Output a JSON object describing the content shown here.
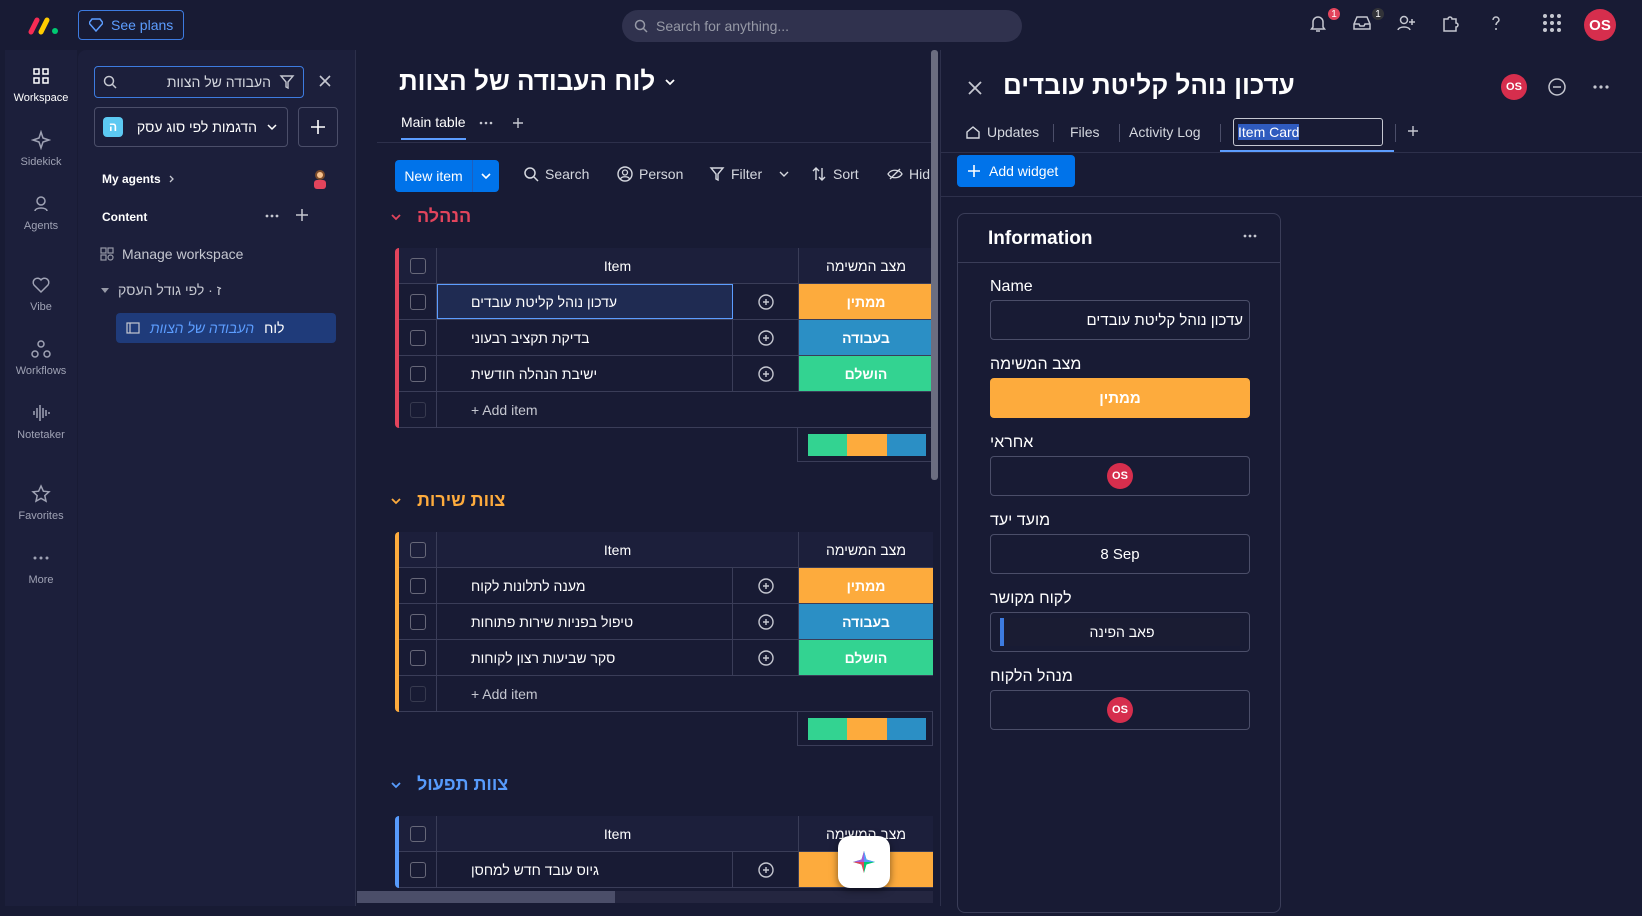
{
  "topbar": {
    "see_plans": "See plans",
    "search_placeholder": "Search for anything...",
    "notif_count": "1",
    "inbox_count": "1",
    "avatar": "OS"
  },
  "rail": {
    "items": [
      {
        "label": "Workspace",
        "icon": "grid-icon"
      },
      {
        "label": "Sidekick",
        "icon": "sparkle-icon"
      },
      {
        "label": "Agents",
        "icon": "agent-icon"
      },
      {
        "label": "Vibe",
        "icon": "heart-icon"
      },
      {
        "label": "Workflows",
        "icon": "workflow-icon"
      },
      {
        "label": "Notetaker",
        "icon": "waveform-icon"
      },
      {
        "label": "Favorites",
        "icon": "star-icon"
      },
      {
        "label": "More",
        "icon": "more-icon"
      }
    ]
  },
  "workspace": {
    "search_value": "העבודה של הצוות",
    "workspace_badge": "ה",
    "workspace_name": "הדגמות לפי סוג עסק",
    "my_agents": "My agents",
    "content": "Content",
    "manage": "Manage workspace",
    "folder": "ז · לפי גודל העסק",
    "board_prefix": "לוח",
    "board_highlight": "העבודה של הצוות"
  },
  "board": {
    "title": "לוח העבודה של הצוות",
    "tab_main": "Main table",
    "new_item": "New item",
    "tools": {
      "search": "Search",
      "person": "Person",
      "filter": "Filter",
      "sort": "Sort",
      "hide": "Hid"
    },
    "col_item": "Item",
    "col_status": "מצב המשימה",
    "add_item": "+ Add item",
    "groups": [
      {
        "title": "הנהלה",
        "color": "#e2445c",
        "rows": [
          {
            "name": "עדכון נוהל קליטת עובדים",
            "status": "ממתין",
            "color": "#fdab3d"
          },
          {
            "name": "בדיקת תקציב רבעוני",
            "status": "בעבודה",
            "color": "#2b8fc5"
          },
          {
            "name": "ישיבת הנהלה חודשית",
            "status": "הושלם",
            "color": "#33d391"
          }
        ]
      },
      {
        "title": "צוות שירות",
        "color": "#fdab3d",
        "rows": [
          {
            "name": "מענה לתלונות לקוח",
            "status": "ממתין",
            "color": "#fdab3d"
          },
          {
            "name": "טיפול בפניות שירות פתוחות",
            "status": "בעבודה",
            "color": "#2b8fc5"
          },
          {
            "name": "סקר שביעות רצון לקוחות",
            "status": "הושלם",
            "color": "#33d391"
          }
        ]
      },
      {
        "title": "צוות תפעול",
        "color": "#579bfc",
        "rows": [
          {
            "name": "גיוס עובד חדש למחסן",
            "status": "",
            "color": "#fdab3d"
          }
        ]
      }
    ]
  },
  "panel": {
    "title": "עדכון נוהל קליטת עובדים",
    "avatar": "OS",
    "tabs": {
      "updates": "Updates",
      "files": "Files",
      "activity": "Activity Log",
      "item_card": "Item Card"
    },
    "add_widget": "Add widget",
    "info_title": "Information",
    "fields": {
      "name_label": "Name",
      "name_value": "עדכון נוהל קליטת עובדים",
      "status_label": "מצב המשימה",
      "status_value": "ממתין",
      "owner_label": "אחראי",
      "owner_avatar": "OS",
      "due_label": "מועד יעד",
      "due_value": "8 Sep",
      "client_label": "לקוח מקושר",
      "client_value": "פאב הפינה",
      "manager_label": "מנהל הלקוח",
      "manager_avatar": "OS"
    }
  },
  "colors": {
    "accent": "#0073ea",
    "pending": "#fdab3d",
    "working": "#2b8fc5",
    "done": "#33d391",
    "avatar": "#d62e4d"
  }
}
